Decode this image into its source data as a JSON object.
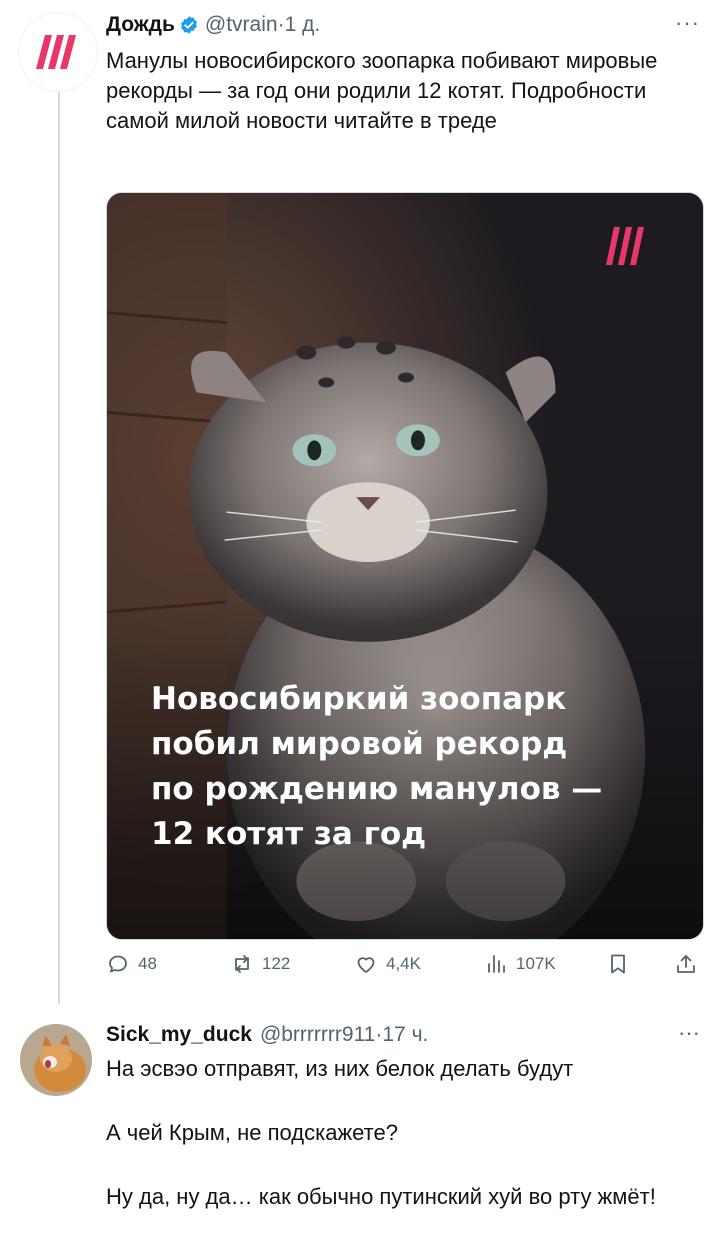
{
  "tweet": {
    "author_name": "Дождь",
    "handle": "@tvrain",
    "separator": " · ",
    "time": "1 д.",
    "more_label": "···",
    "text": "Манулы новосибирского зоопарка побивают мировые рекорды — за год они родили 12 котят. Подробности самой милой новости читайте в треде",
    "media": {
      "overlay_title": "Новосибиркий зоопарк\nпобил мировой рекорд\nпо рождению манулов —\n12 котят за год"
    },
    "actions": {
      "replies": "48",
      "reposts": "122",
      "likes": "4,4K",
      "views": "107K"
    }
  },
  "reply": {
    "author_name": "Sick_my_duck",
    "handle": "@brrrrrrr911",
    "separator": " · ",
    "time": "17 ч.",
    "more_label": "···",
    "paragraphs": [
      "На эсвэо отправят, из них белок делать будут",
      "А чей Крым, не подскажете?",
      "Ну да, ну да… как обычно путинский хуй во рту жмёт!"
    ]
  },
  "colors": {
    "brand_pink": "#e8386a",
    "verified_blue": "#1d9bf0",
    "secondary_text": "#536471"
  },
  "icons": [
    "reply-icon",
    "repost-icon",
    "like-icon",
    "views-icon",
    "bookmark-icon",
    "share-icon",
    "verified-badge-icon"
  ]
}
